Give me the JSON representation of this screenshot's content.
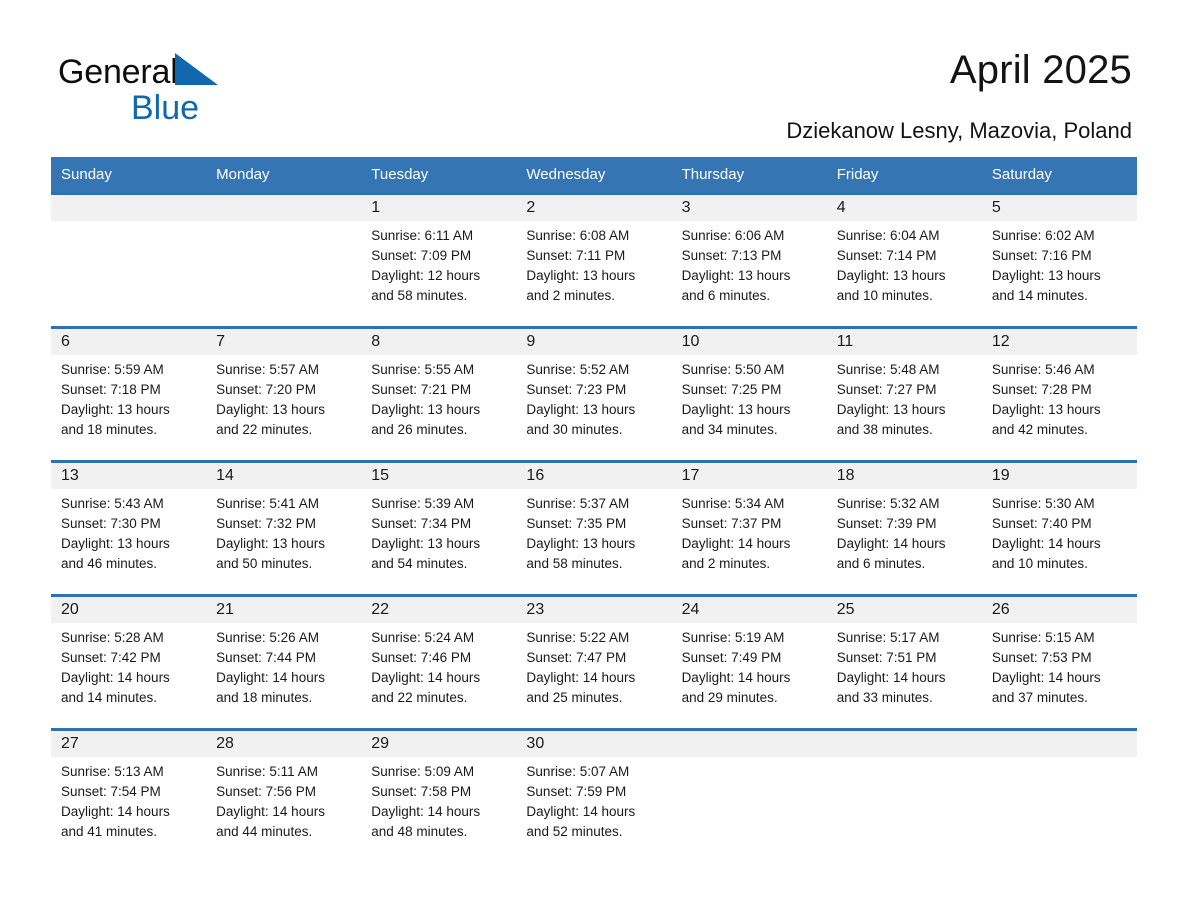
{
  "brand": {
    "name_part1": "General",
    "name_part2": "Blue",
    "triangle_icon": "blue-triangle-icon",
    "accent_color": "#1268ae"
  },
  "header": {
    "title": "April 2025",
    "location": "Dziekanow Lesny, Mazovia, Poland"
  },
  "theme": {
    "header_blue": "#3575b3",
    "row_border_blue": "#2e71b0",
    "daynum_background": "#f1f1f1"
  },
  "calendar": {
    "weekday_headers": [
      "Sunday",
      "Monday",
      "Tuesday",
      "Wednesday",
      "Thursday",
      "Friday",
      "Saturday"
    ],
    "weeks": [
      [
        {
          "day": "",
          "sunrise": "",
          "sunset": "",
          "daylight1": "",
          "daylight2": "",
          "blank": true
        },
        {
          "day": "",
          "sunrise": "",
          "sunset": "",
          "daylight1": "",
          "daylight2": "",
          "blank": true
        },
        {
          "day": "1",
          "sunrise": "Sunrise: 6:11 AM",
          "sunset": "Sunset: 7:09 PM",
          "daylight1": "Daylight: 12 hours",
          "daylight2": "and 58 minutes."
        },
        {
          "day": "2",
          "sunrise": "Sunrise: 6:08 AM",
          "sunset": "Sunset: 7:11 PM",
          "daylight1": "Daylight: 13 hours",
          "daylight2": "and 2 minutes."
        },
        {
          "day": "3",
          "sunrise": "Sunrise: 6:06 AM",
          "sunset": "Sunset: 7:13 PM",
          "daylight1": "Daylight: 13 hours",
          "daylight2": "and 6 minutes."
        },
        {
          "day": "4",
          "sunrise": "Sunrise: 6:04 AM",
          "sunset": "Sunset: 7:14 PM",
          "daylight1": "Daylight: 13 hours",
          "daylight2": "and 10 minutes."
        },
        {
          "day": "5",
          "sunrise": "Sunrise: 6:02 AM",
          "sunset": "Sunset: 7:16 PM",
          "daylight1": "Daylight: 13 hours",
          "daylight2": "and 14 minutes."
        }
      ],
      [
        {
          "day": "6",
          "sunrise": "Sunrise: 5:59 AM",
          "sunset": "Sunset: 7:18 PM",
          "daylight1": "Daylight: 13 hours",
          "daylight2": "and 18 minutes."
        },
        {
          "day": "7",
          "sunrise": "Sunrise: 5:57 AM",
          "sunset": "Sunset: 7:20 PM",
          "daylight1": "Daylight: 13 hours",
          "daylight2": "and 22 minutes."
        },
        {
          "day": "8",
          "sunrise": "Sunrise: 5:55 AM",
          "sunset": "Sunset: 7:21 PM",
          "daylight1": "Daylight: 13 hours",
          "daylight2": "and 26 minutes."
        },
        {
          "day": "9",
          "sunrise": "Sunrise: 5:52 AM",
          "sunset": "Sunset: 7:23 PM",
          "daylight1": "Daylight: 13 hours",
          "daylight2": "and 30 minutes."
        },
        {
          "day": "10",
          "sunrise": "Sunrise: 5:50 AM",
          "sunset": "Sunset: 7:25 PM",
          "daylight1": "Daylight: 13 hours",
          "daylight2": "and 34 minutes."
        },
        {
          "day": "11",
          "sunrise": "Sunrise: 5:48 AM",
          "sunset": "Sunset: 7:27 PM",
          "daylight1": "Daylight: 13 hours",
          "daylight2": "and 38 minutes."
        },
        {
          "day": "12",
          "sunrise": "Sunrise: 5:46 AM",
          "sunset": "Sunset: 7:28 PM",
          "daylight1": "Daylight: 13 hours",
          "daylight2": "and 42 minutes."
        }
      ],
      [
        {
          "day": "13",
          "sunrise": "Sunrise: 5:43 AM",
          "sunset": "Sunset: 7:30 PM",
          "daylight1": "Daylight: 13 hours",
          "daylight2": "and 46 minutes."
        },
        {
          "day": "14",
          "sunrise": "Sunrise: 5:41 AM",
          "sunset": "Sunset: 7:32 PM",
          "daylight1": "Daylight: 13 hours",
          "daylight2": "and 50 minutes."
        },
        {
          "day": "15",
          "sunrise": "Sunrise: 5:39 AM",
          "sunset": "Sunset: 7:34 PM",
          "daylight1": "Daylight: 13 hours",
          "daylight2": "and 54 minutes."
        },
        {
          "day": "16",
          "sunrise": "Sunrise: 5:37 AM",
          "sunset": "Sunset: 7:35 PM",
          "daylight1": "Daylight: 13 hours",
          "daylight2": "and 58 minutes."
        },
        {
          "day": "17",
          "sunrise": "Sunrise: 5:34 AM",
          "sunset": "Sunset: 7:37 PM",
          "daylight1": "Daylight: 14 hours",
          "daylight2": "and 2 minutes."
        },
        {
          "day": "18",
          "sunrise": "Sunrise: 5:32 AM",
          "sunset": "Sunset: 7:39 PM",
          "daylight1": "Daylight: 14 hours",
          "daylight2": "and 6 minutes."
        },
        {
          "day": "19",
          "sunrise": "Sunrise: 5:30 AM",
          "sunset": "Sunset: 7:40 PM",
          "daylight1": "Daylight: 14 hours",
          "daylight2": "and 10 minutes."
        }
      ],
      [
        {
          "day": "20",
          "sunrise": "Sunrise: 5:28 AM",
          "sunset": "Sunset: 7:42 PM",
          "daylight1": "Daylight: 14 hours",
          "daylight2": "and 14 minutes."
        },
        {
          "day": "21",
          "sunrise": "Sunrise: 5:26 AM",
          "sunset": "Sunset: 7:44 PM",
          "daylight1": "Daylight: 14 hours",
          "daylight2": "and 18 minutes."
        },
        {
          "day": "22",
          "sunrise": "Sunrise: 5:24 AM",
          "sunset": "Sunset: 7:46 PM",
          "daylight1": "Daylight: 14 hours",
          "daylight2": "and 22 minutes."
        },
        {
          "day": "23",
          "sunrise": "Sunrise: 5:22 AM",
          "sunset": "Sunset: 7:47 PM",
          "daylight1": "Daylight: 14 hours",
          "daylight2": "and 25 minutes."
        },
        {
          "day": "24",
          "sunrise": "Sunrise: 5:19 AM",
          "sunset": "Sunset: 7:49 PM",
          "daylight1": "Daylight: 14 hours",
          "daylight2": "and 29 minutes."
        },
        {
          "day": "25",
          "sunrise": "Sunrise: 5:17 AM",
          "sunset": "Sunset: 7:51 PM",
          "daylight1": "Daylight: 14 hours",
          "daylight2": "and 33 minutes."
        },
        {
          "day": "26",
          "sunrise": "Sunrise: 5:15 AM",
          "sunset": "Sunset: 7:53 PM",
          "daylight1": "Daylight: 14 hours",
          "daylight2": "and 37 minutes."
        }
      ],
      [
        {
          "day": "27",
          "sunrise": "Sunrise: 5:13 AM",
          "sunset": "Sunset: 7:54 PM",
          "daylight1": "Daylight: 14 hours",
          "daylight2": "and 41 minutes."
        },
        {
          "day": "28",
          "sunrise": "Sunrise: 5:11 AM",
          "sunset": "Sunset: 7:56 PM",
          "daylight1": "Daylight: 14 hours",
          "daylight2": "and 44 minutes."
        },
        {
          "day": "29",
          "sunrise": "Sunrise: 5:09 AM",
          "sunset": "Sunset: 7:58 PM",
          "daylight1": "Daylight: 14 hours",
          "daylight2": "and 48 minutes."
        },
        {
          "day": "30",
          "sunrise": "Sunrise: 5:07 AM",
          "sunset": "Sunset: 7:59 PM",
          "daylight1": "Daylight: 14 hours",
          "daylight2": "and 52 minutes."
        },
        {
          "day": "",
          "sunrise": "",
          "sunset": "",
          "daylight1": "",
          "daylight2": "",
          "blank": true
        },
        {
          "day": "",
          "sunrise": "",
          "sunset": "",
          "daylight1": "",
          "daylight2": "",
          "blank": true
        },
        {
          "day": "",
          "sunrise": "",
          "sunset": "",
          "daylight1": "",
          "daylight2": "",
          "blank": true
        }
      ]
    ]
  }
}
